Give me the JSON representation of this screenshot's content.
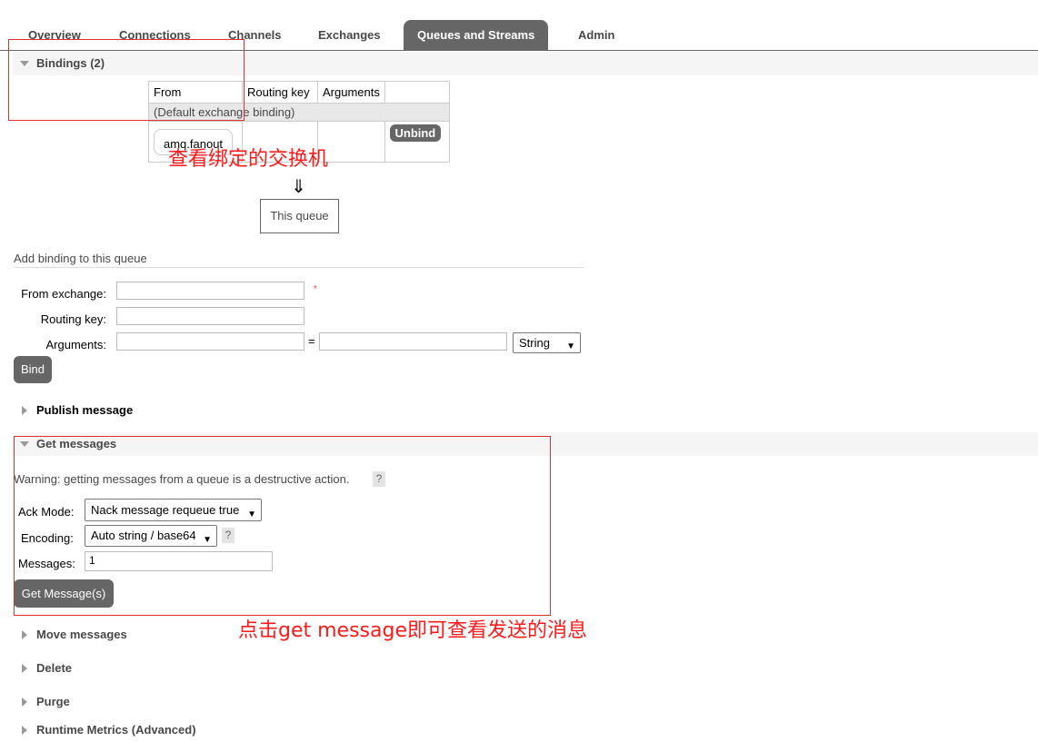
{
  "nav": {
    "tabs": [
      {
        "label": "Overview",
        "active": false
      },
      {
        "label": "Connections",
        "active": false
      },
      {
        "label": "Channels",
        "active": false
      },
      {
        "label": "Exchanges",
        "active": false
      },
      {
        "label": "Queues and Streams",
        "active": true
      },
      {
        "label": "Admin",
        "active": false
      }
    ]
  },
  "bindings": {
    "title": "Bindings (2)",
    "columns": [
      "From",
      "Routing key",
      "Arguments"
    ],
    "default_row": "(Default exchange binding)",
    "rows": [
      {
        "from": "amq.fanout",
        "routing_key": "",
        "arguments": "",
        "action": "Unbind"
      }
    ],
    "arrow": "⇓",
    "this_queue": "This queue"
  },
  "add_binding": {
    "title": "Add binding to this queue",
    "from_exchange_label": "From exchange:",
    "routing_key_label": "Routing key:",
    "arguments_label": "Arguments:",
    "required_mark": "*",
    "equals": "=",
    "type_select": "String",
    "bind_button": "Bind"
  },
  "sections": {
    "publish": "Publish message",
    "get": "Get messages",
    "move": "Move messages",
    "delete": "Delete",
    "purge": "Purge",
    "runtime": "Runtime Metrics (Advanced)"
  },
  "get_messages": {
    "warning": "Warning: getting messages from a queue is a destructive action.",
    "help": "?",
    "ack_mode_label": "Ack Mode:",
    "ack_mode_value": "Nack message requeue true",
    "encoding_label": "Encoding:",
    "encoding_value": "Auto string / base64",
    "messages_label": "Messages:",
    "messages_value": "1",
    "button": "Get Message(s)"
  },
  "annotations": {
    "bindings_note": "查看绑定的交换机",
    "get_note": "点击get message即可查看发送的消息"
  },
  "colors": {
    "annotation": "#ff1a1a",
    "active_tab": "#666666",
    "button": "#666666"
  }
}
